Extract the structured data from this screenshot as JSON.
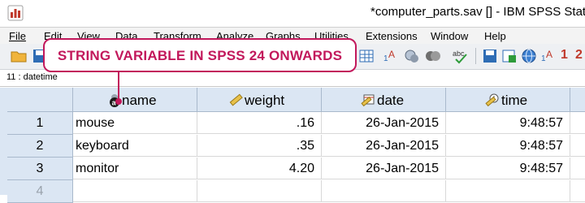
{
  "window": {
    "title": "*computer_parts.sav [] - IBM SPSS Statis"
  },
  "menu": {
    "items": [
      {
        "label": "File",
        "key": "F"
      },
      {
        "label": "Edit"
      },
      {
        "label": "View"
      },
      {
        "label": "Data"
      },
      {
        "label": "Transform"
      },
      {
        "label": "Analyze"
      },
      {
        "label": "Graphs"
      },
      {
        "label": "Utilities"
      },
      {
        "label": "Extensions"
      },
      {
        "label": "Window"
      },
      {
        "label": "Help"
      }
    ]
  },
  "cellbar": {
    "ref": "11 : datetime"
  },
  "callout": {
    "text": "STRING VARIABLE IN SPSS 24 ONWARDS"
  },
  "grid": {
    "columns": [
      {
        "name": "name",
        "icon": "string-variable-icon"
      },
      {
        "name": "weight",
        "icon": "scale-ruler-icon"
      },
      {
        "name": "date",
        "icon": "date-scale-icon"
      },
      {
        "name": "time",
        "icon": "time-scale-icon"
      },
      {
        "name": ""
      }
    ],
    "rows": [
      {
        "num": "1",
        "name": "mouse",
        "weight": ".16",
        "date": "26-Jan-2015",
        "time": "9:48:57"
      },
      {
        "num": "2",
        "name": "keyboard",
        "weight": ".35",
        "date": "26-Jan-2015",
        "time": "9:48:57"
      },
      {
        "num": "3",
        "name": "monitor",
        "weight": "4.20",
        "date": "26-Jan-2015",
        "time": "9:48:57"
      },
      {
        "num": "4",
        "name": "",
        "weight": "",
        "date": "",
        "time": ""
      }
    ]
  },
  "toolbar_right": {
    "number_1": "1",
    "number_2": "2"
  },
  "colors": {
    "accent": "#c2185b",
    "header_bg": "#dbe6f3"
  }
}
